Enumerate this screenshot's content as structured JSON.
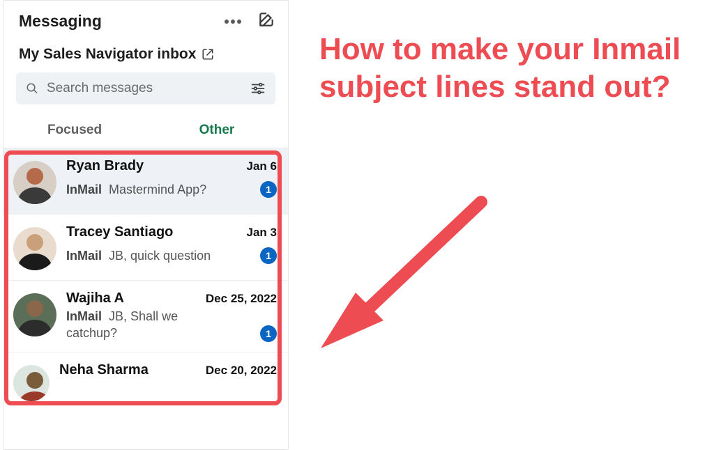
{
  "header": {
    "title": "Messaging"
  },
  "inbox_link": {
    "label": "My Sales Navigator inbox"
  },
  "search": {
    "placeholder": "Search messages"
  },
  "tabs": {
    "focused": "Focused",
    "other": "Other",
    "active": "other"
  },
  "messages": [
    {
      "name": "Ryan Brady",
      "date": "Jan 6",
      "prefix": "InMail",
      "subject": "Mastermind App?",
      "unread": "1",
      "selected": true,
      "avatar_colors": [
        "#d7cfc5",
        "#b56b4a"
      ]
    },
    {
      "name": "Tracey Santiago",
      "date": "Jan 3",
      "prefix": "InMail",
      "subject": "JB, quick question",
      "unread": "1",
      "selected": false,
      "avatar_colors": [
        "#e9dcce",
        "#1a1a1a"
      ]
    },
    {
      "name": "Wajiha A",
      "date": "Dec 25, 2022",
      "prefix": "InMail",
      "subject": "JB, Shall we catchup?",
      "unread": "1",
      "selected": false,
      "avatar_colors": [
        "#5a6e58",
        "#2c2c2c"
      ]
    },
    {
      "name": "Neha Sharma",
      "date": "Dec 20, 2022",
      "prefix": "",
      "subject": "",
      "unread": "",
      "selected": false,
      "avatar_colors": [
        "#dce5e0",
        "#7a5c3b"
      ]
    }
  ],
  "annotation": {
    "headline": "How to make your Inmail subject lines stand out?"
  },
  "colors": {
    "accent_green": "#16794c",
    "badge_blue": "#0b66c3",
    "annotation_red": "#ee4c53"
  }
}
